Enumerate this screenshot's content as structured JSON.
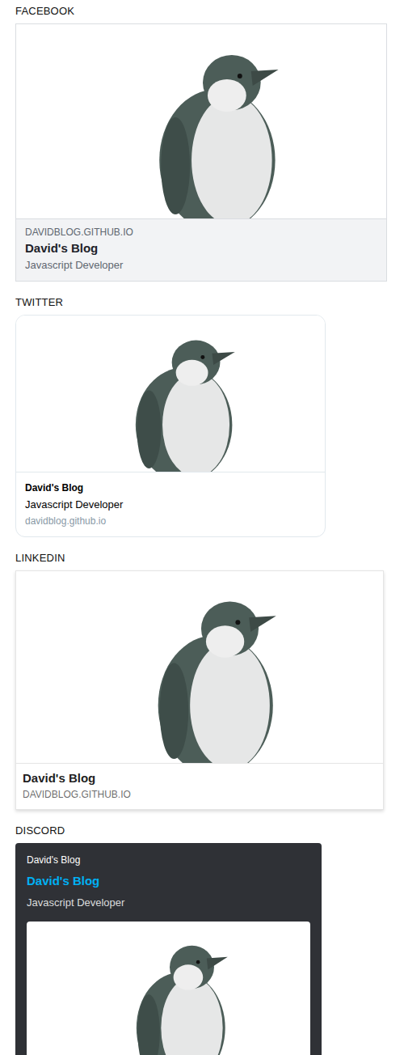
{
  "previews": [
    {
      "label": "FACEBOOK",
      "kind": "facebook",
      "domain": "DAVIDBLOG.GITHUB.IO",
      "title": "David's Blog",
      "description": "Javascript Developer"
    },
    {
      "label": "TWITTER",
      "kind": "twitter",
      "title": "David's Blog",
      "description": "Javascript Developer",
      "domain": "davidblog.github.io"
    },
    {
      "label": "LINKEDIN",
      "kind": "linkedin",
      "title": "David's Blog",
      "domain": "DAVIDBLOG.GITHUB.IO"
    },
    {
      "label": "DISCORD",
      "kind": "discord",
      "site": "David's Blog",
      "title": "David's Blog",
      "description": "Javascript Developer"
    }
  ]
}
